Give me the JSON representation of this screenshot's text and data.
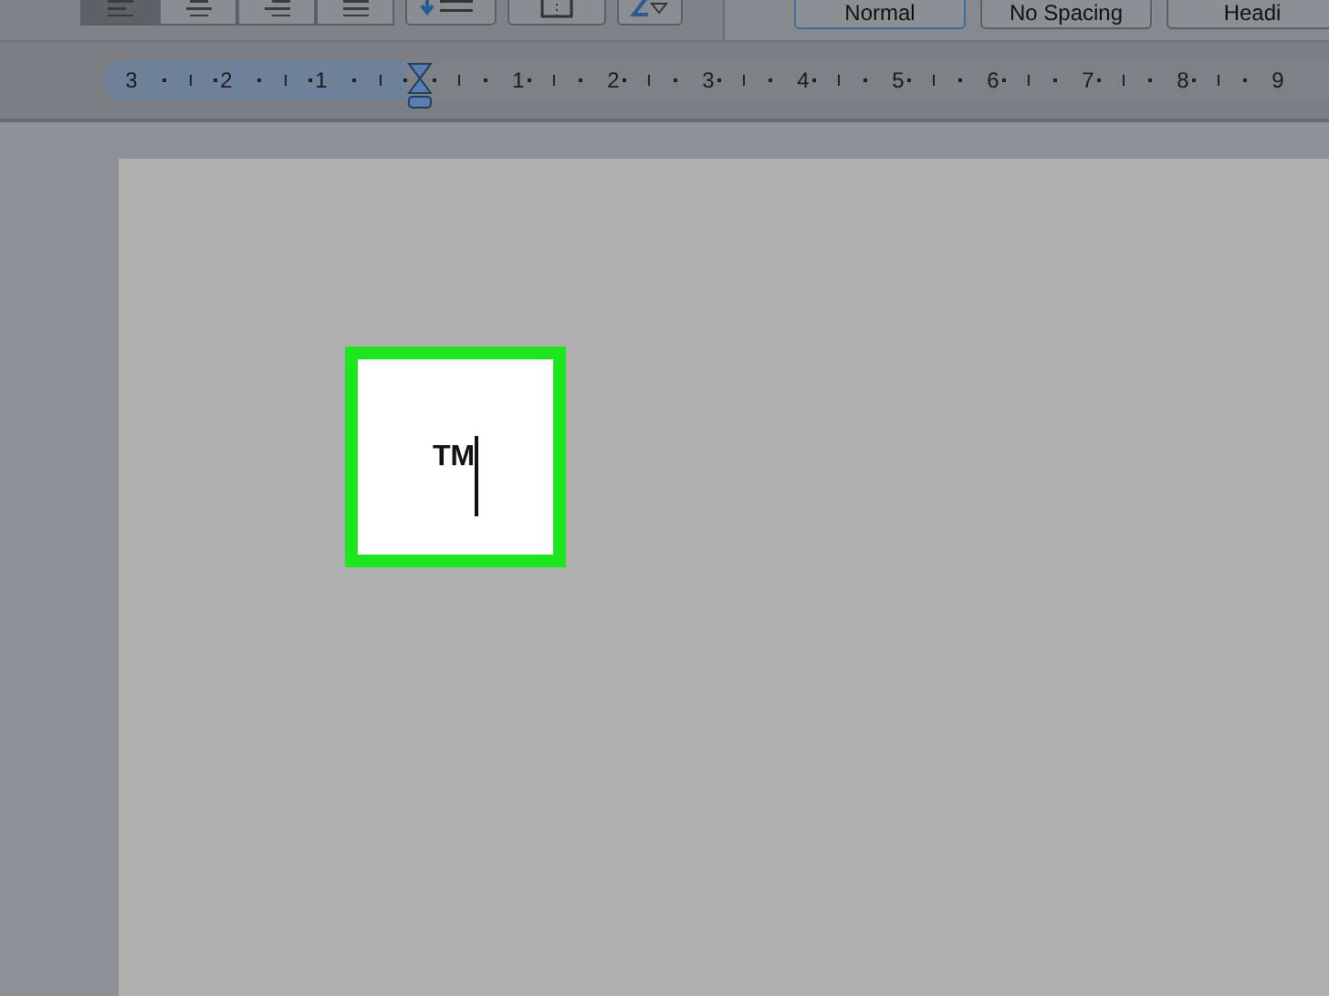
{
  "toolbar": {
    "align_buttons": [
      {
        "kind": "left",
        "selected": true
      },
      {
        "kind": "center",
        "selected": false
      },
      {
        "kind": "right",
        "selected": false
      },
      {
        "kind": "justify",
        "selected": false
      }
    ],
    "styles": [
      {
        "label": "Normal",
        "selected": true
      },
      {
        "label": "No Spacing",
        "selected": false
      },
      {
        "label": "Headi",
        "selected": false
      }
    ]
  },
  "ruler": {
    "left_numbers": [
      "3",
      "2",
      "1"
    ],
    "right_numbers": [
      "1",
      "2",
      "3",
      "4",
      "5",
      "6",
      "7",
      "8",
      "9"
    ]
  },
  "document": {
    "text": "TM",
    "highlighted": true
  }
}
